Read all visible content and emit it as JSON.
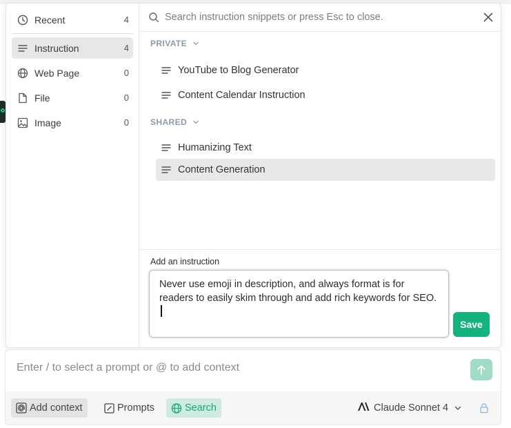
{
  "sidebar": {
    "items": [
      {
        "icon": "clock-icon",
        "label": "Recent",
        "count": "4"
      },
      {
        "icon": "lines-icon",
        "label": "Instruction",
        "count": "4"
      },
      {
        "icon": "globe-icon",
        "label": "Web Page",
        "count": "0"
      },
      {
        "icon": "file-icon",
        "label": "File",
        "count": "0"
      },
      {
        "icon": "image-icon",
        "label": "Image",
        "count": "0"
      }
    ]
  },
  "search": {
    "placeholder": "Search instruction snippets or press Esc to close.",
    "value": ""
  },
  "sections": [
    {
      "title": "PRIVATE",
      "items": [
        "YouTube to Blog Generator",
        "Content Calendar Instruction"
      ]
    },
    {
      "title": "SHARED",
      "items": [
        "Humanizing Text",
        "Content Generation"
      ]
    }
  ],
  "editor": {
    "label": "Add an instruction",
    "value": "Never use emoji in description, and always format is for readers to easily skim through and add rich keywords for SEO.",
    "save_label": "Save"
  },
  "chat": {
    "placeholder": "Enter / to select a prompt or @ to add context",
    "add_context_label": "Add context",
    "prompts_label": "Prompts",
    "search_label": "Search",
    "model_label": "Claude Sonnet 4"
  },
  "colors": {
    "accent": "#13b27e",
    "send_button": "#9fdcc3",
    "selected_row": "#e8e8e8",
    "section_header": "#8e9aa8"
  }
}
